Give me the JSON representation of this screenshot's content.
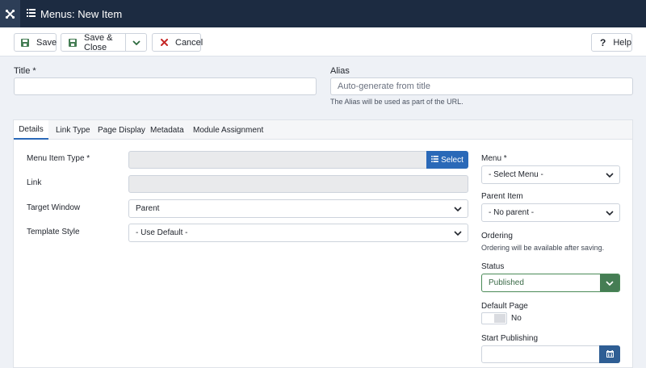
{
  "header": {
    "title": "Menus: New Item"
  },
  "toolbar": {
    "save_label": "Save",
    "save_close_label": "Save & Close",
    "cancel_label": "Cancel",
    "help_label": "Help"
  },
  "form": {
    "title_label": "Title *",
    "title_value": "",
    "alias_label": "Alias",
    "alias_placeholder": "Auto-generate from title",
    "alias_hint": "The Alias will be used as part of the URL."
  },
  "tabs": [
    {
      "label": "Details",
      "active": true
    },
    {
      "label": "Link Type",
      "active": false
    },
    {
      "label": "Page Display",
      "active": false
    },
    {
      "label": "Metadata",
      "active": false
    },
    {
      "label": "Module Assignment",
      "active": false
    }
  ],
  "details": {
    "menu_item_type_label": "Menu Item Type *",
    "select_button_label": "Select",
    "link_label": "Link",
    "target_window_label": "Target Window",
    "target_window_value": "Parent",
    "template_style_label": "Template Style",
    "template_style_value": "- Use Default -"
  },
  "sidebar": {
    "menu_label": "Menu *",
    "menu_value": "- Select Menu -",
    "parent_item_label": "Parent Item",
    "parent_item_value": "- No parent -",
    "ordering_label": "Ordering",
    "ordering_note": "Ordering will be available after saving.",
    "status_label": "Status",
    "status_value": "Published",
    "default_page_label": "Default Page",
    "default_page_value": "No",
    "start_publishing_label": "Start Publishing"
  },
  "colors": {
    "topbar": "#1c2b41",
    "primary": "#2a69b8",
    "success": "#457d54",
    "danger": "#c52827"
  },
  "icons": [
    "joomla-logo-icon",
    "list-icon",
    "save-icon",
    "chevron-down-icon",
    "close-icon",
    "question-icon",
    "calendar-icon"
  ]
}
